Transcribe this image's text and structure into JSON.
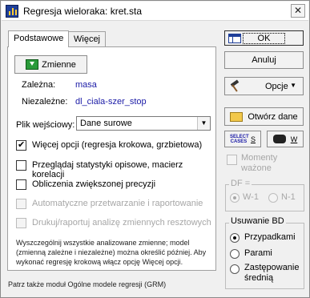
{
  "window": {
    "title": "Regresja wieloraka: kret.sta",
    "close_glyph": "✕"
  },
  "tabs": [
    {
      "label": "Podstawowe"
    },
    {
      "label": "Więcej"
    }
  ],
  "variables_button": {
    "label": "Zmienne"
  },
  "dependent": {
    "label": "Zależna:",
    "value": "masa"
  },
  "independent": {
    "label": "Niezależne:",
    "value": "dl_ciala-szer_stop"
  },
  "input_file": {
    "label": "Plik wejściowy:",
    "value": "Dane surowe"
  },
  "options": [
    {
      "label": "Więcej opcji (regresja krokowa, grzbietowa)",
      "checked": true,
      "enabled": true
    },
    {
      "label": "Przeglądaj statystyki opisowe, macierz korelacji",
      "checked": false,
      "enabled": true
    },
    {
      "label": "Obliczenia zwiększonej precyzji",
      "checked": false,
      "enabled": true
    },
    {
      "label": "Automatyczne przetwarzanie i raportowanie",
      "checked": false,
      "enabled": false
    },
    {
      "label": "Drukuj/raportuj analizę zmiennych resztowych",
      "checked": false,
      "enabled": false
    }
  ],
  "hint": "Wyszczególnij wszystkie analizowane zmienne; model (zmienną zależne i niezależne) można określić później. Aby wykonać regresję krokową włącz opcję Więcej opcji.",
  "footer_note": "Patrz także moduł Ogólne modele regresji (GRM)",
  "right_buttons": {
    "ok": "OK",
    "cancel": "Anuluj",
    "options": "Opcje",
    "open_data": "Otwórz dane",
    "select_cases": "SELECT CASES",
    "select_cases_symbol": "S",
    "weight_symbol": "W"
  },
  "weighted_moments": {
    "label": "Momenty ważone",
    "checked": false,
    "enabled": false
  },
  "df_group": {
    "title": "DF =",
    "options": [
      {
        "label": "W-1",
        "checked": true
      },
      {
        "label": "N-1",
        "checked": false
      }
    ]
  },
  "missing_data": {
    "title": "Usuwanie BD",
    "options": [
      {
        "label": "Przypadkami",
        "checked": true
      },
      {
        "label": "Parami",
        "checked": false
      },
      {
        "label": "Zastępowanie średnią",
        "checked": false
      }
    ]
  }
}
